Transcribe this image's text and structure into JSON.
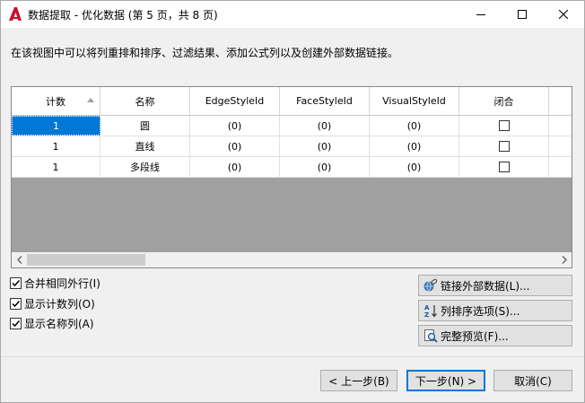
{
  "window": {
    "title": "数据提取 - 优化数据 (第 5 页，共 8 页)",
    "description": "在该视图中可以将列重排和排序、过滤结果、添加公式列以及创建外部数据链接。",
    "colors": {
      "accent": "#0078d7",
      "app_icon_red": "#c8102e",
      "grid_empty": "#a0a0a0"
    }
  },
  "grid": {
    "columns": [
      "计数",
      "名称",
      "EdgeStyleId",
      "FaceStyleId",
      "VisualStyleId",
      "闭合"
    ],
    "sort_column": "计数",
    "rows": [
      {
        "count": "1",
        "name": "圆",
        "edge": "(0)",
        "face": "(0)",
        "visual": "(0)",
        "closed": false
      },
      {
        "count": "1",
        "name": "直线",
        "edge": "(0)",
        "face": "(0)",
        "visual": "(0)",
        "closed": false
      },
      {
        "count": "1",
        "name": "多段线",
        "edge": "(0)",
        "face": "(0)",
        "visual": "(0)",
        "closed": false
      }
    ]
  },
  "options": {
    "merge_rows": {
      "label": "合并相同外行(I)",
      "checked": true
    },
    "show_count": {
      "label": "显示计数列(O)",
      "checked": true
    },
    "show_name": {
      "label": "显示名称列(A)",
      "checked": true
    }
  },
  "side_buttons": {
    "link_external": "链接外部数据(L)...",
    "sort_options": "列排序选项(S)...",
    "full_preview": "完整预览(F)..."
  },
  "footer": {
    "back": "< 上一步(B)",
    "next": "下一步(N) >",
    "cancel": "取消(C)"
  }
}
